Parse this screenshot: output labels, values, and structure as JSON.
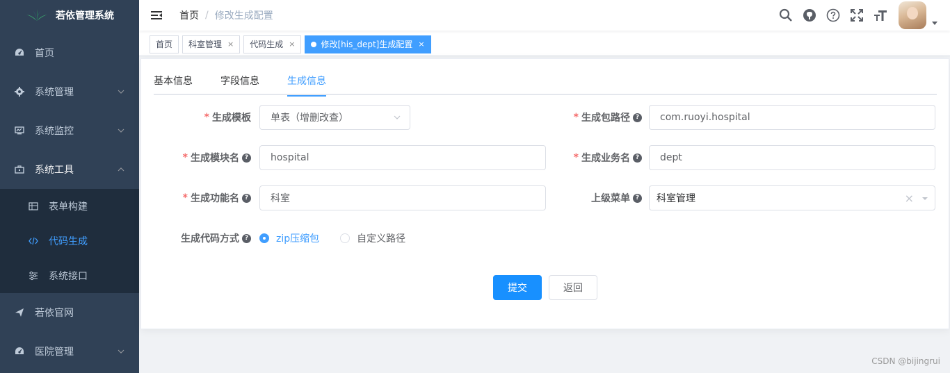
{
  "app": {
    "title": "若依管理系统"
  },
  "sidebar": {
    "items": [
      {
        "label": "首页",
        "icon": "dashboard-icon"
      },
      {
        "label": "系统管理",
        "icon": "gear-icon",
        "expandable": true
      },
      {
        "label": "系统监控",
        "icon": "monitor-icon",
        "expandable": true
      },
      {
        "label": "系统工具",
        "icon": "toolbox-icon",
        "expandable": true,
        "open": true
      },
      {
        "label": "若依官网",
        "icon": "paper-plane-icon"
      },
      {
        "label": "医院管理",
        "icon": "dashboard-icon",
        "expandable": true
      }
    ],
    "subitems": [
      {
        "label": "表单构建",
        "icon": "form-grid-icon"
      },
      {
        "label": "代码生成",
        "icon": "code-icon",
        "active": true
      },
      {
        "label": "系统接口",
        "icon": "sliders-icon"
      }
    ]
  },
  "breadcrumb": {
    "home": "首页",
    "separator": "/",
    "current": "修改生成配置"
  },
  "tags": [
    {
      "label": "首页",
      "closable": false
    },
    {
      "label": "科室管理",
      "closable": true
    },
    {
      "label": "代码生成",
      "closable": true
    },
    {
      "label": "修改[his_dept]生成配置",
      "closable": true,
      "active": true
    }
  ],
  "tabs": [
    {
      "label": "基本信息"
    },
    {
      "label": "字段信息"
    },
    {
      "label": "生成信息",
      "active": true
    }
  ],
  "form": {
    "template": {
      "label": "生成模板",
      "value": "单表（增删改查）"
    },
    "package": {
      "label": "生成包路径",
      "value": "com.ruoyi.hospital"
    },
    "module": {
      "label": "生成模块名",
      "value": "hospital"
    },
    "business": {
      "label": "生成业务名",
      "value": "dept"
    },
    "function": {
      "label": "生成功能名",
      "value": "科室"
    },
    "parent_menu": {
      "label": "上级菜单",
      "value": "科室管理"
    },
    "gen_type": {
      "label": "生成代码方式",
      "options": [
        "zip压缩包",
        "自定义路径"
      ],
      "selected": "zip压缩包"
    }
  },
  "buttons": {
    "submit": "提交",
    "back": "返回"
  },
  "tag_close_glyph": "×",
  "clear_glyph": "×",
  "required_mark": "*",
  "help_glyph": "?",
  "watermark": "CSDN @bijingrui",
  "colors": {
    "sidebar_bg": "#304156",
    "submenu_bg": "#1f2d3d",
    "accent": "#409eff",
    "primary_button": "#1890ff",
    "required": "#f56c6c"
  }
}
